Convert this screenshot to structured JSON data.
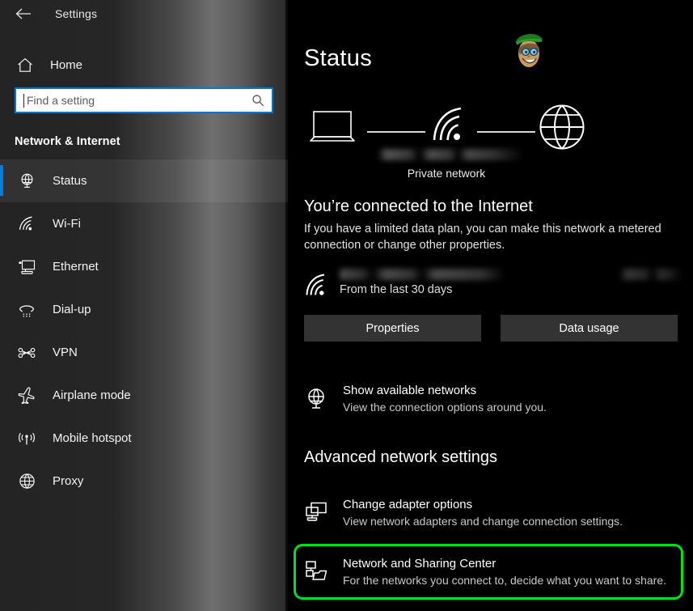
{
  "window": {
    "title": "Settings",
    "back_icon": "back-arrow-icon"
  },
  "sidebar": {
    "home": {
      "label": "Home",
      "icon": "home-icon"
    },
    "search": {
      "value": "",
      "placeholder": "Find a setting",
      "icon": "search-icon"
    },
    "category": "Network & Internet",
    "items": [
      {
        "label": "Status",
        "icon": "globe-monitor-icon",
        "selected": true
      },
      {
        "label": "Wi-Fi",
        "icon": "wifi-icon",
        "selected": false
      },
      {
        "label": "Ethernet",
        "icon": "ethernet-icon",
        "selected": false
      },
      {
        "label": "Dial-up",
        "icon": "dialup-phone-icon",
        "selected": false
      },
      {
        "label": "VPN",
        "icon": "vpn-icon",
        "selected": false
      },
      {
        "label": "Airplane mode",
        "icon": "airplane-icon",
        "selected": false
      },
      {
        "label": "Mobile hotspot",
        "icon": "hotspot-icon",
        "selected": false
      },
      {
        "label": "Proxy",
        "icon": "globe-icon",
        "selected": false
      }
    ]
  },
  "content": {
    "page_title": "Status",
    "mascot": "cartoon-avatar-icon",
    "diagram": {
      "device_icon": "laptop-icon",
      "link_icon": "wifi-icon",
      "internet_icon": "globe-icon",
      "network_name": "",
      "network_type": "Private network"
    },
    "connection": {
      "heading": "You’re connected to the Internet",
      "description": "If you have a limited data plan, you can make this network a metered connection or change other properties."
    },
    "usage": {
      "icon": "wifi-icon",
      "network_name": "",
      "amount": "",
      "period": "From the last 30 days"
    },
    "buttons": [
      {
        "label": "Properties"
      },
      {
        "label": "Data usage"
      }
    ],
    "show_networks": {
      "icon": "globe-monitor-icon",
      "title": "Show available networks",
      "description": "View the connection options around you."
    },
    "advanced": {
      "heading": "Advanced network settings",
      "items": [
        {
          "icon": "adapter-icon",
          "title": "Change adapter options",
          "description": "View network adapters and change connection settings.",
          "highlighted": false
        },
        {
          "icon": "sharing-center-icon",
          "title": "Network and Sharing Center",
          "description": "For the networks you connect to, decide what you want to share.",
          "highlighted": true
        }
      ]
    },
    "watermark": ""
  },
  "colors": {
    "accent_blue": "#0078d7",
    "highlight_green": "#00e020",
    "button_bg": "#333333",
    "content_bg": "#000000"
  }
}
